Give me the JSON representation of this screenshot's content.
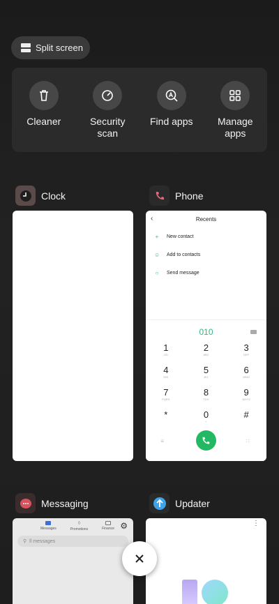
{
  "split_screen_label": "Split screen",
  "tools": [
    {
      "icon": "trash-icon",
      "label": "Cleaner"
    },
    {
      "icon": "security-gauge-icon",
      "label": "Security scan"
    },
    {
      "icon": "find-apps-icon",
      "label": "Find apps"
    },
    {
      "icon": "grid-icon",
      "label": "Manage apps"
    }
  ],
  "apps": {
    "clock": {
      "name": "Clock",
      "icon": "clock-icon"
    },
    "phone": {
      "name": "Phone",
      "icon": "phone-icon",
      "title": "Recents",
      "actions": [
        "New contact",
        "Add to contacts",
        "Send message"
      ],
      "dialed": "010",
      "keys": [
        {
          "d": "1",
          "l": "GD"
        },
        {
          "d": "2",
          "l": "ABC"
        },
        {
          "d": "3",
          "l": "DEF"
        },
        {
          "d": "4",
          "l": "GHI"
        },
        {
          "d": "5",
          "l": "JKL"
        },
        {
          "d": "6",
          "l": "MNO"
        },
        {
          "d": "7",
          "l": "PQRS"
        },
        {
          "d": "8",
          "l": "TUV"
        },
        {
          "d": "9",
          "l": "WXYZ"
        },
        {
          "d": "*",
          "l": ""
        },
        {
          "d": "0",
          "l": "+"
        },
        {
          "d": "#",
          "l": ""
        }
      ]
    },
    "messaging": {
      "name": "Messaging",
      "icon": "messaging-icon",
      "tabs": [
        "Messages",
        "Promotions",
        "Finance"
      ],
      "search_placeholder": "ll messages"
    },
    "updater": {
      "name": "Updater",
      "icon": "updater-arrow-icon"
    }
  },
  "colors": {
    "accent_green": "#25b864",
    "updater_blue": "#3fa3e8",
    "background": "#1e1e1e"
  }
}
